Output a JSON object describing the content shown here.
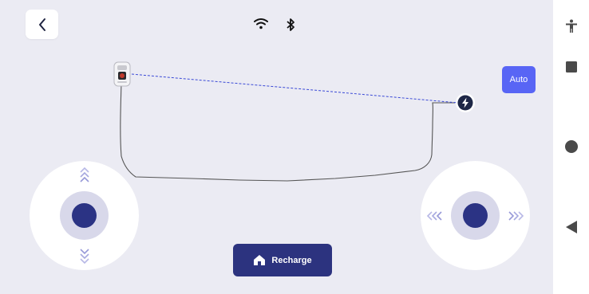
{
  "header": {
    "back_icon": "chevron-left-icon",
    "status": [
      "wifi-icon",
      "bluetooth-icon"
    ]
  },
  "map": {
    "robot_icon": "robot-mower-icon",
    "dock_icon": "charging-station-icon"
  },
  "mode": {
    "label": "Auto"
  },
  "controls": {
    "left_joystick": "forward-backward-joystick",
    "right_joystick": "left-right-joystick"
  },
  "recharge": {
    "label": "Recharge",
    "icon": "home-icon"
  },
  "system_nav": [
    "accessibility-icon",
    "recents-icon",
    "home-circle-icon",
    "back-triangle-icon"
  ],
  "colors": {
    "background": "#ebebf3",
    "accent": "#5865f5",
    "dark_accent": "#2c337f",
    "path_line": "#555555",
    "dashed_link": "#3a49d6"
  }
}
